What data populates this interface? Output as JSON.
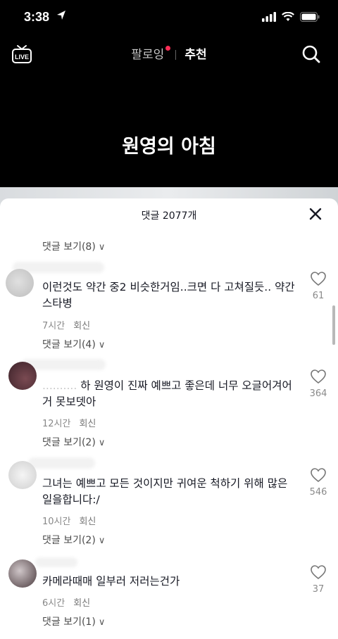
{
  "status_bar": {
    "time": "3:38"
  },
  "nav": {
    "live_label": "LIVE",
    "tab_following": "팔로잉",
    "tab_recommended": "추천"
  },
  "video": {
    "caption": "원영의 아침"
  },
  "comments_panel": {
    "title": "댓글 2077개",
    "top_replies": "댓글 보기(8)",
    "comments": [
      {
        "text": "이런것도 약간 중2 비슷한거임..크면 다 고쳐질듯.. 약간 스타병",
        "time": "7시간",
        "reply": "회신",
        "replies": "댓글 보기(4)",
        "likes": "61"
      },
      {
        "mention": "..........",
        "text": "하 원영이 진짜 예쁘고 좋은데 너무 오글어겨어거 못보뎃아",
        "time": "12시간",
        "reply": "회신",
        "replies": "댓글 보기(2)",
        "likes": "364"
      },
      {
        "text": "그녀는 예쁘고 모든 것이지만 귀여운 척하기 위해 많은 일을합니다:/",
        "time": "10시간",
        "reply": "회신",
        "replies": "댓글 보기(2)",
        "likes": "546"
      },
      {
        "text": "카메라때매 일부러 저러는건가",
        "time": "6시간",
        "reply": "회신",
        "replies": "댓글 보기(1)",
        "likes": "37"
      }
    ]
  }
}
